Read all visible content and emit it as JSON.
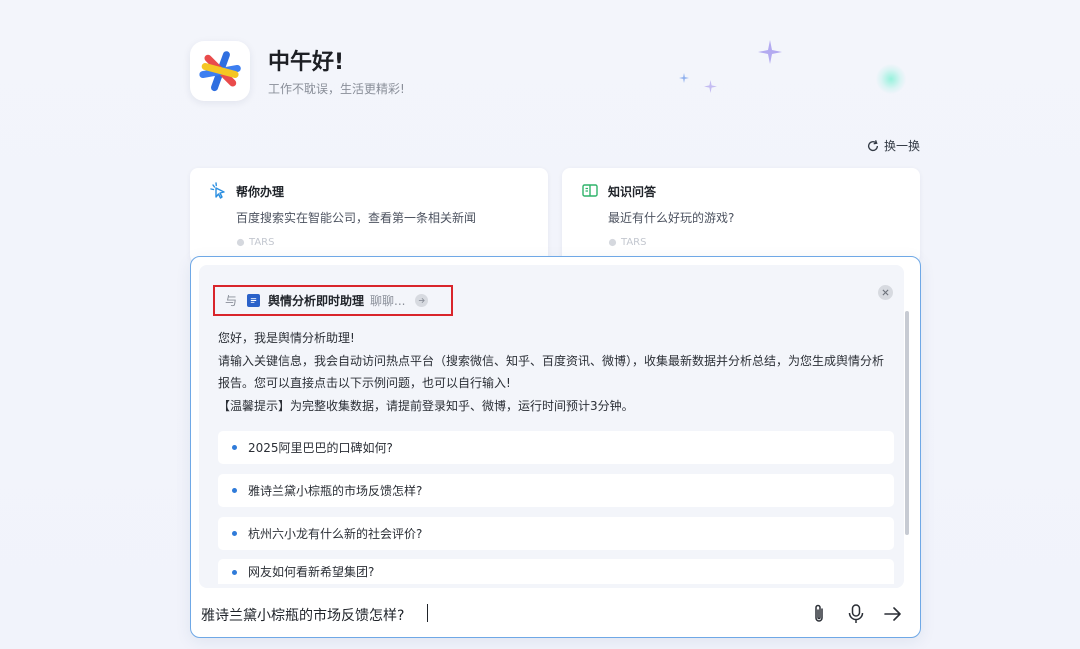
{
  "header": {
    "greeting": "中午好!",
    "subtitle": "工作不耽误，生活更精彩!"
  },
  "refresh_label": "换一换",
  "suggestion_cards": [
    {
      "title": "帮你办理",
      "desc": "百度搜索实在智能公司，查看第一条相关新闻",
      "tag": "TARS",
      "icon": "cursor-click-icon"
    },
    {
      "title": "知识问答",
      "desc": "最近有什么好玩的游戏?",
      "tag": "TARS",
      "icon": "book-icon"
    }
  ],
  "dialog": {
    "with_label": "与",
    "agent_name": "舆情分析即时助理",
    "agent_mode": "聊聊...",
    "intro": [
      "您好，我是舆情分析助理!",
      "请输入关键信息，我会自动访问热点平台（搜索微信、知乎、百度资讯、微博），收集最新数据并分析总结，为您生成舆情分析报告。您可以直接点击以下示例问题，也可以自行输入!",
      "【温馨提示】为完整收集数据，请提前登录知乎、微博，运行时间预计3分钟。"
    ],
    "questions": [
      "2025阿里巴巴的口碑如何?",
      "雅诗兰黛小棕瓶的市场反馈怎样?",
      "杭州六小龙有什么新的社会评价?",
      "网友如何看新希望集团?"
    ]
  },
  "input": {
    "value": "雅诗兰黛小棕瓶的市场反馈怎样?"
  },
  "colors": {
    "accent_blue": "#2f7bd9",
    "highlight_red": "#d9252b",
    "input_border": "#6fa8e6"
  }
}
